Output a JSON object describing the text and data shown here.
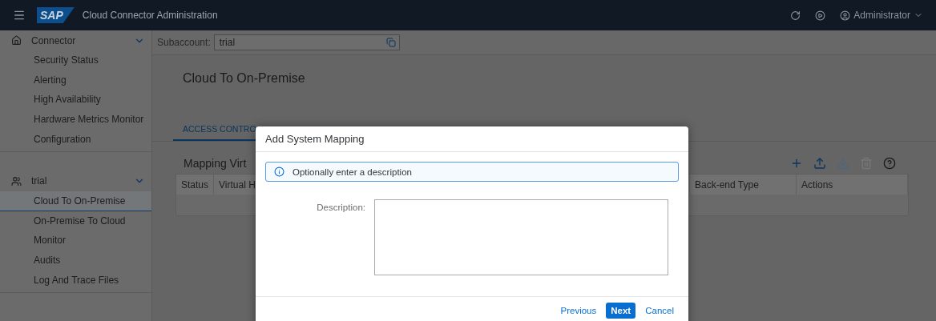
{
  "header": {
    "logo": "SAP",
    "title": "Cloud Connector Administration",
    "user": "Administrator"
  },
  "sidebar": {
    "groups": [
      {
        "label": "Connector",
        "kind": "home",
        "expanded": true,
        "items": [
          {
            "label": "Security Status",
            "selected": false
          },
          {
            "label": "Alerting",
            "selected": false
          },
          {
            "label": "High Availability",
            "selected": false
          },
          {
            "label": "Hardware Metrics Monitor",
            "selected": false
          },
          {
            "label": "Configuration",
            "selected": false
          }
        ]
      },
      {
        "label": "trial",
        "kind": "account",
        "expanded": true,
        "items": [
          {
            "label": "Cloud To On-Premise",
            "selected": true
          },
          {
            "label": "On-Premise To Cloud",
            "selected": false
          },
          {
            "label": "Monitor",
            "selected": false
          },
          {
            "label": "Audits",
            "selected": false
          },
          {
            "label": "Log And Trace Files",
            "selected": false
          }
        ]
      }
    ]
  },
  "subaccount": {
    "label": "Subaccount:",
    "value": "trial"
  },
  "page_title": "Cloud To On-Premise",
  "tabs": [
    {
      "label": "ACCESS CONTRO",
      "selected": true
    }
  ],
  "section_title": "Mapping Virt",
  "table": {
    "columns": [
      "Status",
      "Virtual H",
      "Back-end Type",
      "Actions"
    ]
  },
  "dialog": {
    "title": "Add System Mapping",
    "message": "Optionally enter a description",
    "field": {
      "label": "Description:"
    },
    "buttons": [
      {
        "label": "Previous",
        "kind": "link"
      },
      {
        "label": "Next",
        "kind": "primary"
      },
      {
        "label": "Cancel",
        "kind": "link"
      }
    ]
  }
}
